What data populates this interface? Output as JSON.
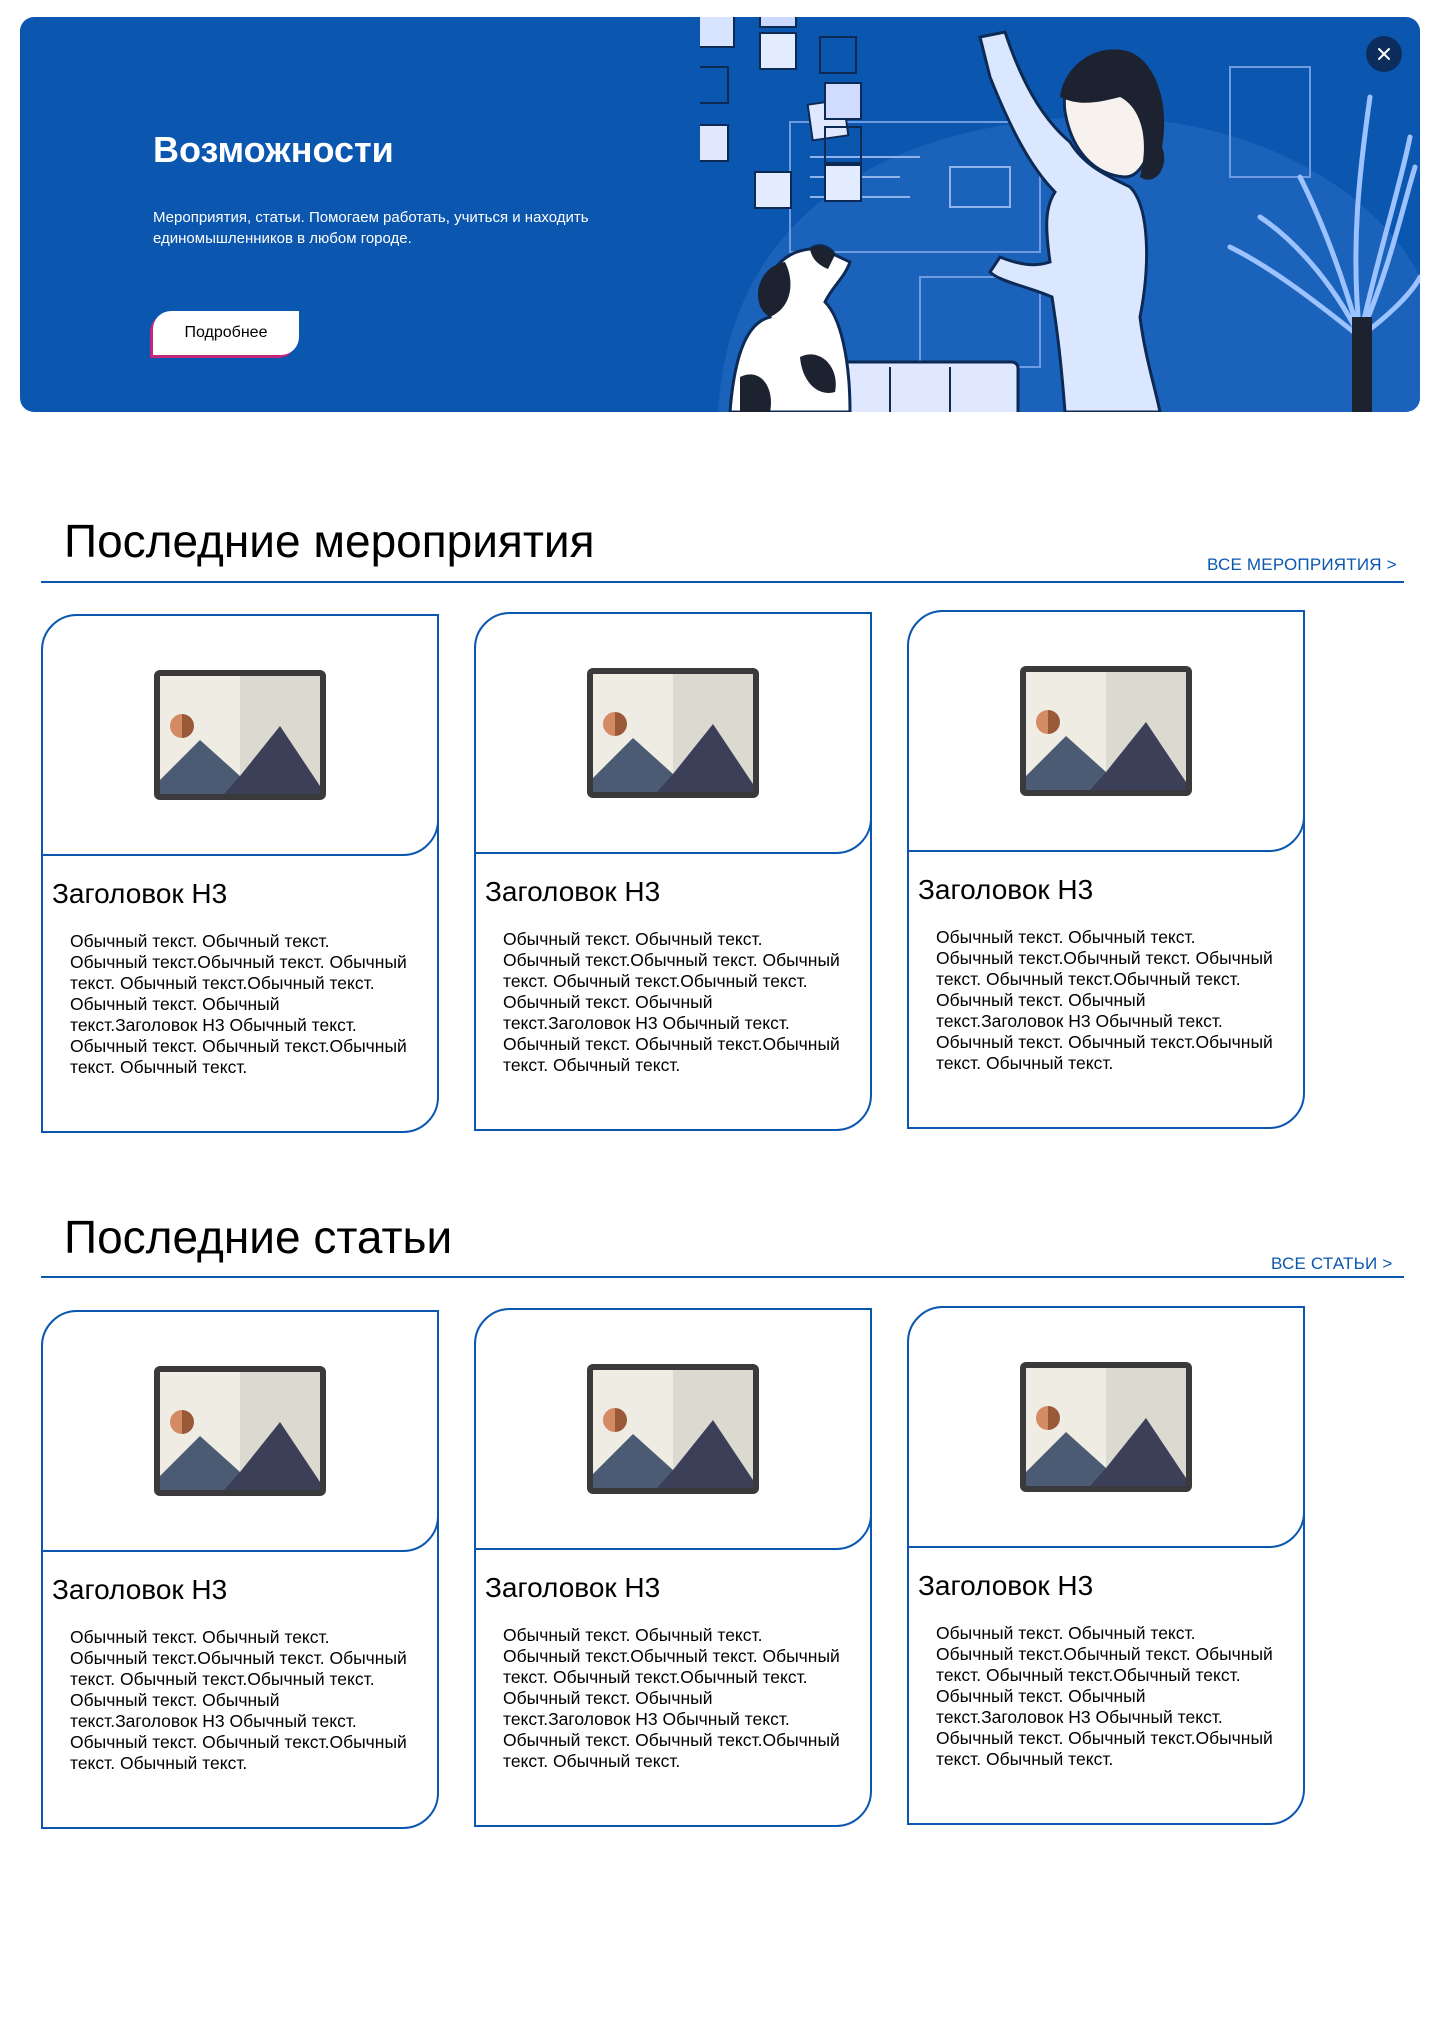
{
  "hero": {
    "title": "Возможности",
    "text": "Мероприятия, статьи.  Помогаем работать, учиться и находить единомышленников в любом городе.",
    "button_label": "Подробнее",
    "close_icon": "close-icon"
  },
  "events": {
    "title": "Последние мероприятия",
    "link": "ВСЕ МЕРОПРИЯТИЯ >",
    "cards": [
      {
        "title": "Заголовок Н3",
        "text": "Обычный текст. Обычный текст. Обычный текст.Обычный текст. Обычный текст. Обычный текст.Обычный текст. Обычный текст. Обычный текст.Заголовок Н3 Обычный текст. Обычный текст. Обычный текст.Обычный текст. Обычный текст.",
        "image": "image-placeholder-icon"
      },
      {
        "title": "Заголовок Н3",
        "text": "Обычный текст. Обычный текст. Обычный текст.Обычный текст. Обычный текст. Обычный текст.Обычный текст. Обычный текст. Обычный текст.Заголовок Н3 Обычный текст. Обычный текст. Обычный текст.Обычный текст. Обычный текст.",
        "image": "image-placeholder-icon"
      },
      {
        "title": "Заголовок Н3",
        "text": "Обычный текст. Обычный текст. Обычный текст.Обычный текст. Обычный текст. Обычный текст.Обычный текст. Обычный текст. Обычный текст.Заголовок Н3 Обычный текст. Обычный текст. Обычный текст.Обычный текст. Обычный текст.",
        "image": "image-placeholder-icon"
      }
    ]
  },
  "articles": {
    "title": "Последние статьи",
    "link": "ВСЕ СТАТЬИ >",
    "cards": [
      {
        "title": "Заголовок Н3",
        "text": "Обычный текст. Обычный текст. Обычный текст.Обычный текст. Обычный текст. Обычный текст.Обычный текст. Обычный текст. Обычный текст.Заголовок Н3 Обычный текст. Обычный текст. Обычный текст.Обычный текст. Обычный текст.",
        "image": "image-placeholder-icon"
      },
      {
        "title": "Заголовок Н3",
        "text": "Обычный текст. Обычный текст. Обычный текст.Обычный текст. Обычный текст. Обычный текст.Обычный текст. Обычный текст. Обычный текст.Заголовок Н3 Обычный текст. Обычный текст. Обычный текст.Обычный текст. Обычный текст.",
        "image": "image-placeholder-icon"
      },
      {
        "title": "Заголовок Н3",
        "text": "Обычный текст. Обычный текст. Обычный текст.Обычный текст. Обычный текст. Обычный текст.Обычный текст. Обычный текст. Обычный текст.Заголовок Н3 Обычный текст. Обычный текст. Обычный текст.Обычный текст. Обычный текст.",
        "image": "image-placeholder-icon"
      }
    ]
  },
  "colors": {
    "brand_blue": "#0b57b0",
    "button_accent": "#c2277a",
    "close_bg": "#0c2d5c"
  }
}
